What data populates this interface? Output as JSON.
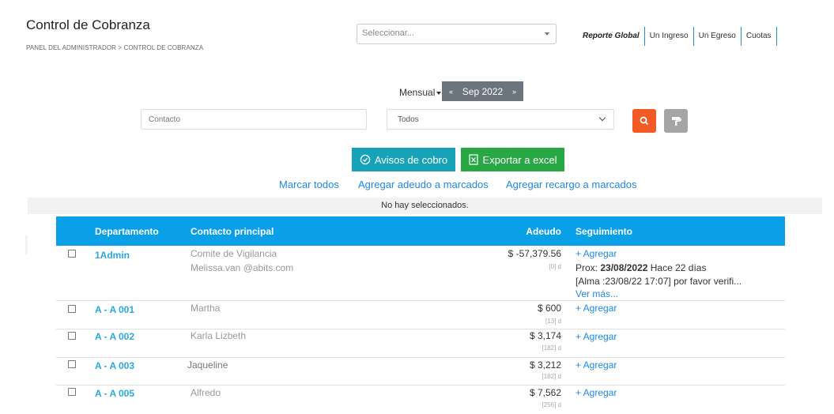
{
  "header": {
    "title": "Control de Cobranza",
    "breadcrumb": "PANEL DEL ADMINISTRADOR > CONTROL DE COBRANZA",
    "selector_placeholder": "Seleccionar...",
    "links": [
      "Reporte Global",
      "Un Ingreso",
      "Un Egreso",
      "Cuotas"
    ]
  },
  "filters": {
    "period_type": "Mensual",
    "prev": "«",
    "period": "Sep 2022",
    "next": "»",
    "contact_placeholder": "Contacto",
    "status_value": "Todos"
  },
  "actions": {
    "cobro_label": "Avisos de cobro",
    "excel_label": "Exportar a excel",
    "mark_all": "Marcar todos",
    "add_debt": "Agregar adeudo a marcados",
    "add_surcharge": "Agregar recargo a marcados"
  },
  "selection_status": "No hay seleccionados.",
  "table": {
    "headers": [
      "Departamento",
      "Contacto principal",
      "Adeudo",
      "Seguimiento"
    ],
    "rows": [
      {
        "depto": "1Admin",
        "contact": "Comite de Vigilancia",
        "email": "Melissa.van @abits.com",
        "amount": "$ -57,379.56",
        "days": "[0] d",
        "add": "+ Agregar",
        "next_prefix": "Prox:",
        "next_date": "23/08/2022",
        "next_suffix": "Hace 22 días",
        "note": "[Alma :23/08/22 17:07] por favor verifi...",
        "more": "Ver más..."
      },
      {
        "depto": "A - A 001",
        "contact": "Martha",
        "amount": "$ 600",
        "days": "[13] d",
        "add": "+ Agregar"
      },
      {
        "depto": "A - A 002",
        "contact": "Karla Lizbeth",
        "amount": "$ 3,174",
        "days": "[182] d",
        "add": "+ Agregar"
      },
      {
        "depto": "A - A 003",
        "contact": "Jaqueline",
        "amount": "$ 3,212",
        "days": "[182] d",
        "add": "+ Agregar"
      },
      {
        "depto": "A - A 005",
        "contact": "Alfredo",
        "amount": "$ 7,562",
        "days": "[256] d",
        "add": "+ Agregar"
      }
    ]
  },
  "colors": {
    "accent": "#0aa0e8",
    "link": "#1e88e5",
    "search": "#f15a24",
    "excel": "#28a745",
    "cobro": "#17a2b8"
  }
}
